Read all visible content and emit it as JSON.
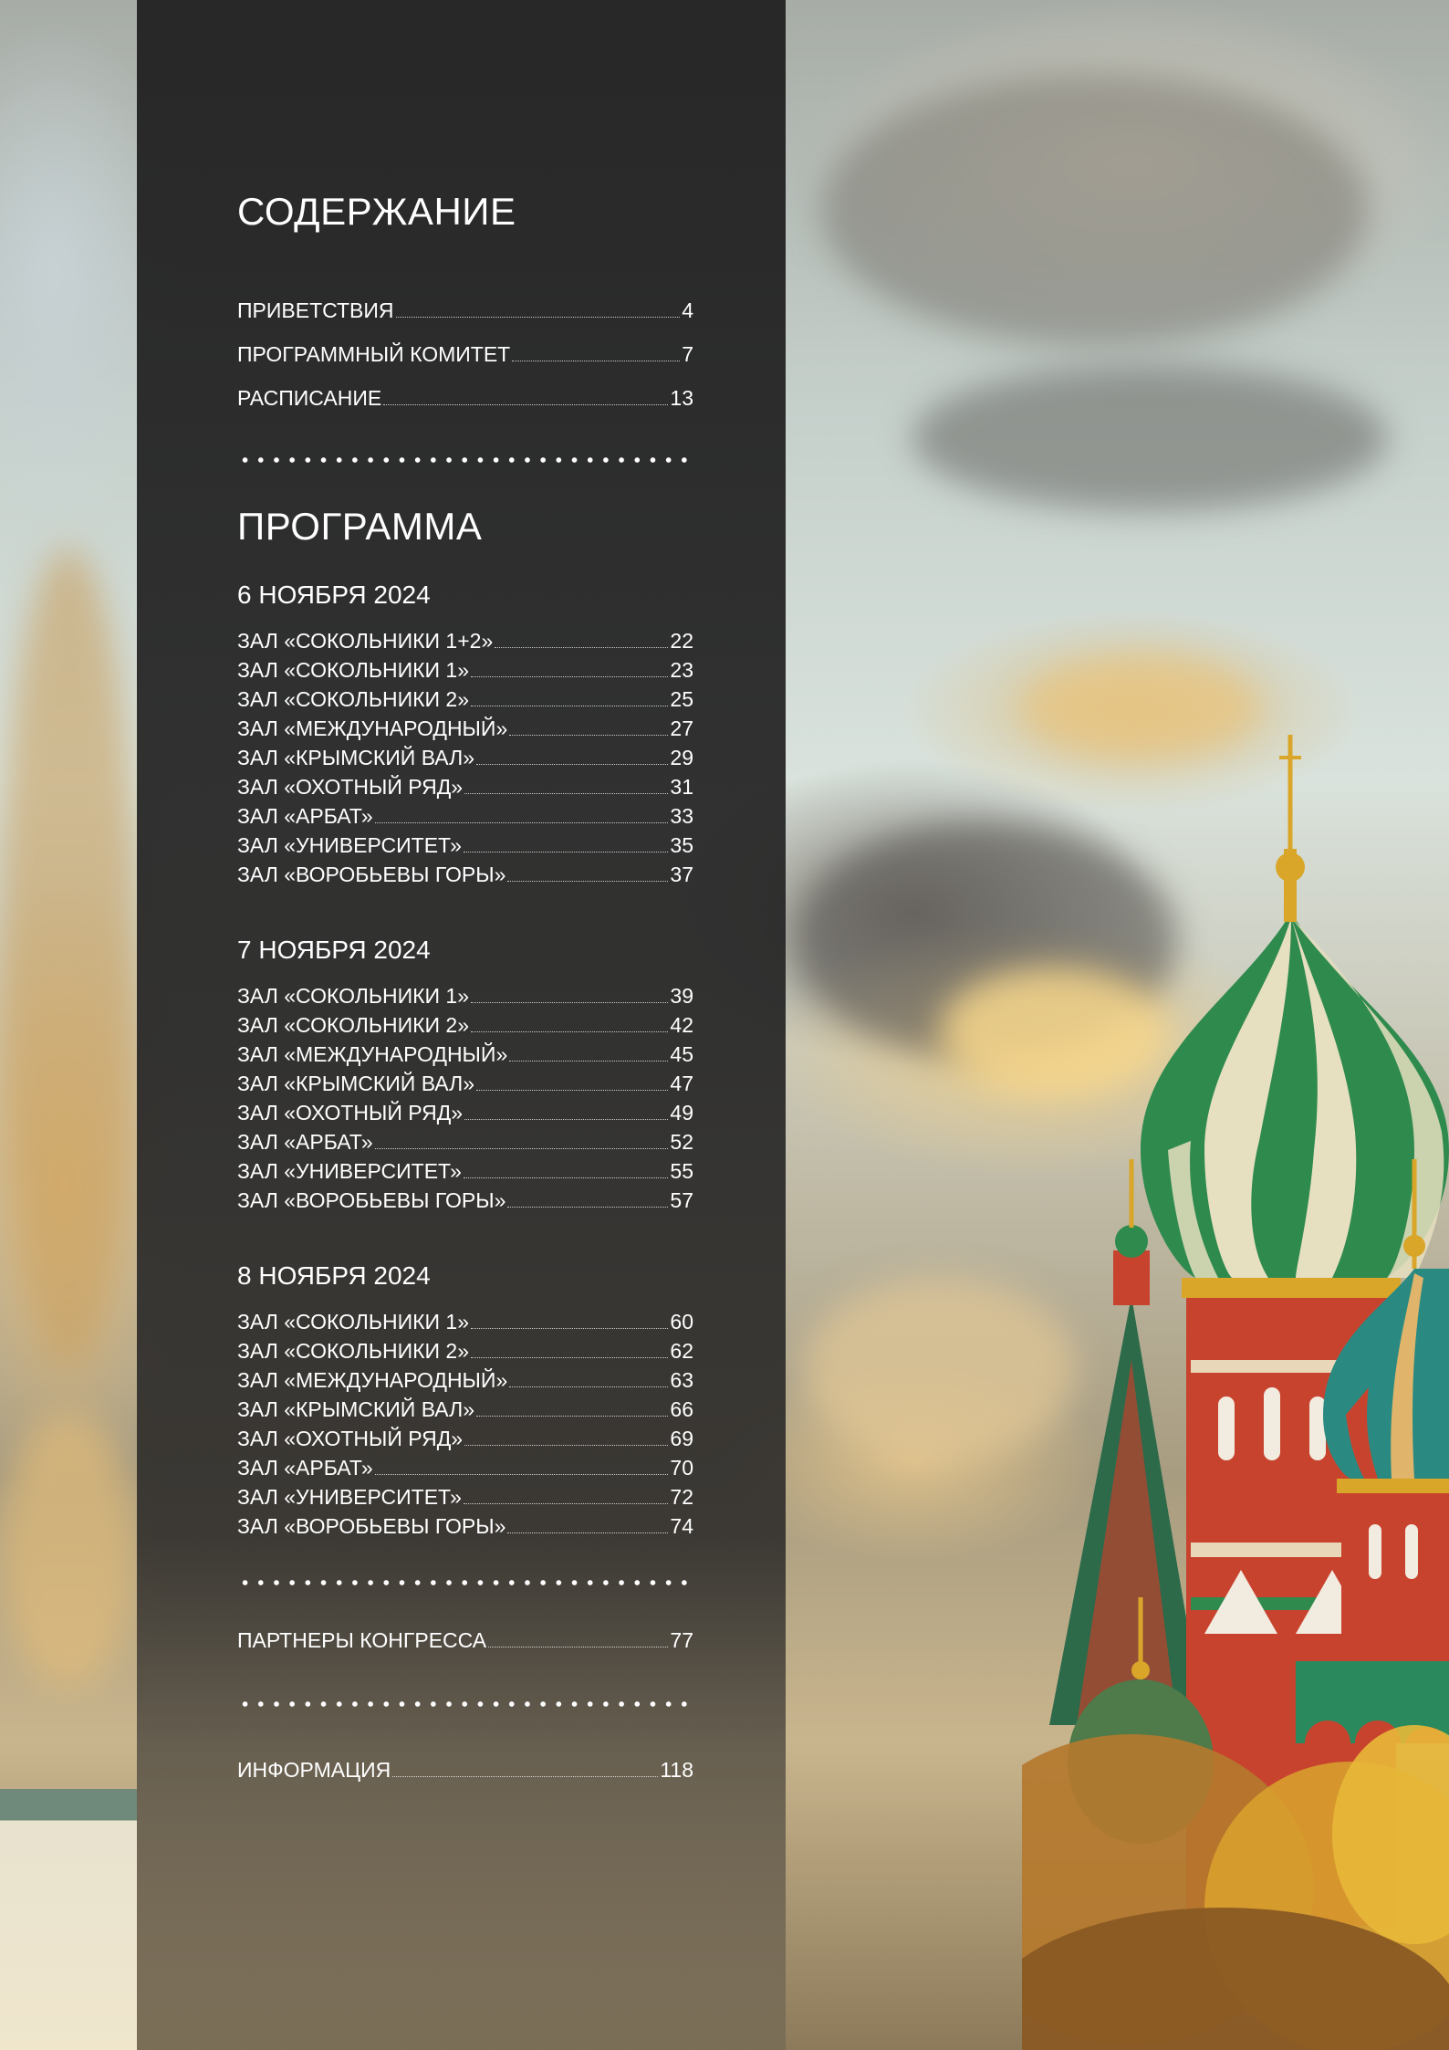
{
  "contents": {
    "title": "СОДЕРЖАНИЕ",
    "items": [
      {
        "label": "ПРИВЕТСТВИЯ",
        "page": "4"
      },
      {
        "label": "ПРОГРАММНЫЙ КОМИТЕТ",
        "page": "7"
      },
      {
        "label": "РАСПИСАНИЕ",
        "page": "13"
      }
    ]
  },
  "program": {
    "title": "ПРОГРАММА",
    "days": [
      {
        "date": "6 НОЯБРЯ 2024",
        "halls": [
          {
            "label": "ЗАЛ «СОКОЛЬНИКИ 1+2»",
            "page": "22"
          },
          {
            "label": "ЗАЛ «СОКОЛЬНИКИ 1»",
            "page": "23"
          },
          {
            "label": "ЗАЛ «СОКОЛЬНИКИ 2»",
            "page": "25"
          },
          {
            "label": "ЗАЛ «МЕЖДУНАРОДНЫЙ»",
            "page": "27"
          },
          {
            "label": "ЗАЛ «КРЫМСКИЙ ВАЛ»",
            "page": "29"
          },
          {
            "label": "ЗАЛ «ОХОТНЫЙ РЯД»",
            "page": "31"
          },
          {
            "label": "ЗАЛ «АРБАТ»",
            "page": "33"
          },
          {
            "label": "ЗАЛ «УНИВЕРСИТЕТ»",
            "page": "35"
          },
          {
            "label": "ЗАЛ «ВОРОБЬЕВЫ ГОРЫ»",
            "page": "37"
          }
        ]
      },
      {
        "date": "7 НОЯБРЯ 2024",
        "halls": [
          {
            "label": "ЗАЛ «СОКОЛЬНИКИ 1»",
            "page": "39"
          },
          {
            "label": "ЗАЛ «СОКОЛЬНИКИ 2»",
            "page": "42"
          },
          {
            "label": "ЗАЛ «МЕЖДУНАРОДНЫЙ»",
            "page": "45"
          },
          {
            "label": "ЗАЛ «КРЫМСКИЙ ВАЛ»",
            "page": "47"
          },
          {
            "label": "ЗАЛ «ОХОТНЫЙ РЯД»",
            "page": "49"
          },
          {
            "label": "ЗАЛ «АРБАТ»",
            "page": "52"
          },
          {
            "label": "ЗАЛ «УНИВЕРСИТЕТ»",
            "page": "55"
          },
          {
            "label": "ЗАЛ «ВОРОБЬЕВЫ ГОРЫ»",
            "page": "57"
          }
        ]
      },
      {
        "date": "8 НОЯБРЯ 2024",
        "halls": [
          {
            "label": "ЗАЛ «СОКОЛЬНИКИ 1»",
            "page": "60"
          },
          {
            "label": "ЗАЛ «СОКОЛЬНИКИ 2»",
            "page": "62"
          },
          {
            "label": "ЗАЛ «МЕЖДУНАРОДНЫЙ»",
            "page": "63"
          },
          {
            "label": "ЗАЛ «КРЫМСКИЙ ВАЛ»",
            "page": "66"
          },
          {
            "label": "ЗАЛ «ОХОТНЫЙ РЯД»",
            "page": "69"
          },
          {
            "label": "ЗАЛ «АРБАТ»",
            "page": "70"
          },
          {
            "label": "ЗАЛ «УНИВЕРСИТЕТ»",
            "page": "72"
          },
          {
            "label": "ЗАЛ «ВОРОБЬЕВЫ ГОРЫ»",
            "page": "74"
          }
        ]
      }
    ]
  },
  "partners": {
    "label": "ПАРТНЕРЫ КОНГРЕССА",
    "page": "77"
  },
  "info": {
    "label": "ИНФОРМАЦИЯ",
    "page": "118"
  },
  "colors": {
    "panel": "#2a2a2a",
    "text": "#ffffff",
    "dome_green": "#2f8a4e",
    "dome_cream": "#e6dfc0",
    "tower_red": "#c8432e",
    "gold": "#d9a62a"
  }
}
